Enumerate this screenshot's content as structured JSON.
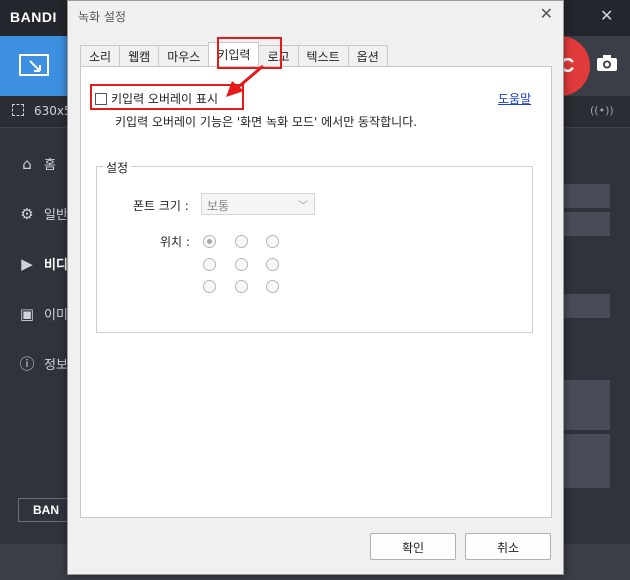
{
  "background_app": {
    "logo": "BANDI",
    "size_text": "630x5",
    "rec_label": "C",
    "sidebar": [
      {
        "label": "홈",
        "icon": "home-icon"
      },
      {
        "label": "일반",
        "icon": "gear-icon"
      },
      {
        "label": "비디",
        "icon": "video-icon"
      },
      {
        "label": "이미",
        "icon": "image-icon"
      },
      {
        "label": "정보",
        "icon": "info-icon"
      }
    ],
    "bottom_button": "BAN"
  },
  "dialog": {
    "title": "녹화 설정",
    "tabs": [
      {
        "label": "소리"
      },
      {
        "label": "웹캠"
      },
      {
        "label": "마우스"
      },
      {
        "label": "키입력",
        "selected": true
      },
      {
        "label": "로고"
      },
      {
        "label": "텍스트"
      },
      {
        "label": "옵션"
      }
    ],
    "keystroke": {
      "show_overlay_label": "키입력 오버레이 표시",
      "show_overlay_checked": false,
      "help_link": "도움말",
      "description": "키입력 오버레이 기능은 '화면 녹화 모드' 에서만 동작합니다.",
      "settings_group": "설정",
      "font_size_label": "폰트 크기 :",
      "font_size_value": "보통",
      "position_label": "위치 :",
      "position_selected": "top-left"
    },
    "ok_button": "확인",
    "cancel_button": "취소"
  },
  "colors": {
    "highlight": "#e51b1b",
    "link": "#1a3fd0",
    "accent": "#3d8fe0",
    "rec": "#e03a3a"
  }
}
